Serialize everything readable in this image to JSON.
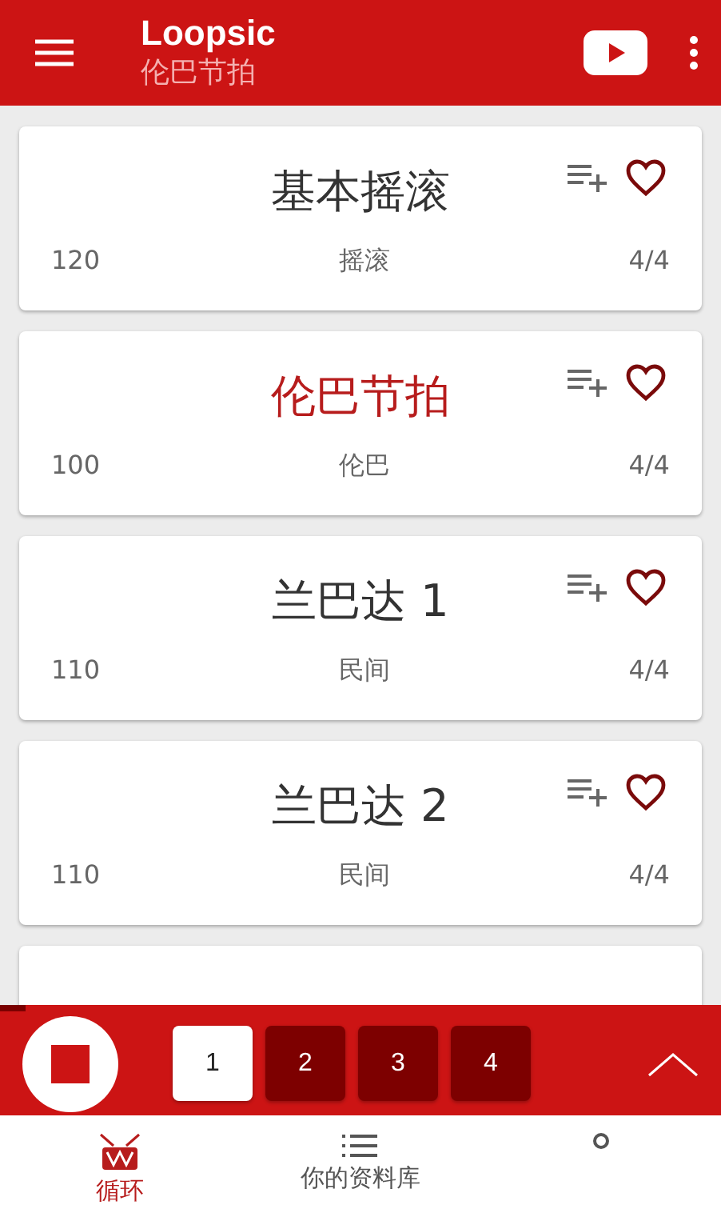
{
  "app_bar": {
    "title": "Loopsic",
    "subtitle": "伦巴节拍"
  },
  "beats": [
    {
      "name": "基本摇滚",
      "tempo": "120",
      "genre": "摇滚",
      "meter": "4/4",
      "selected": false
    },
    {
      "name": "伦巴节拍",
      "tempo": "100",
      "genre": "伦巴",
      "meter": "4/4",
      "selected": true
    },
    {
      "name": "兰巴达 1",
      "tempo": "110",
      "genre": "民间",
      "meter": "4/4",
      "selected": false
    },
    {
      "name": "兰巴达 2",
      "tempo": "110",
      "genre": "民间",
      "meter": "4/4",
      "selected": false
    },
    {
      "kind": "partial"
    }
  ],
  "progress": {
    "level": 0.035
  },
  "bars": [
    {
      "label": "1",
      "selected": true
    },
    {
      "label": "2",
      "selected": false
    },
    {
      "label": "3",
      "selected": false
    },
    {
      "label": "4",
      "selected": false
    }
  ],
  "nav": [
    {
      "kind": "drum",
      "label": "循环",
      "selected": true
    },
    {
      "kind": "list",
      "label": "你的资料库",
      "selected": false
    },
    {
      "kind": "person",
      "selected": false
    }
  ]
}
